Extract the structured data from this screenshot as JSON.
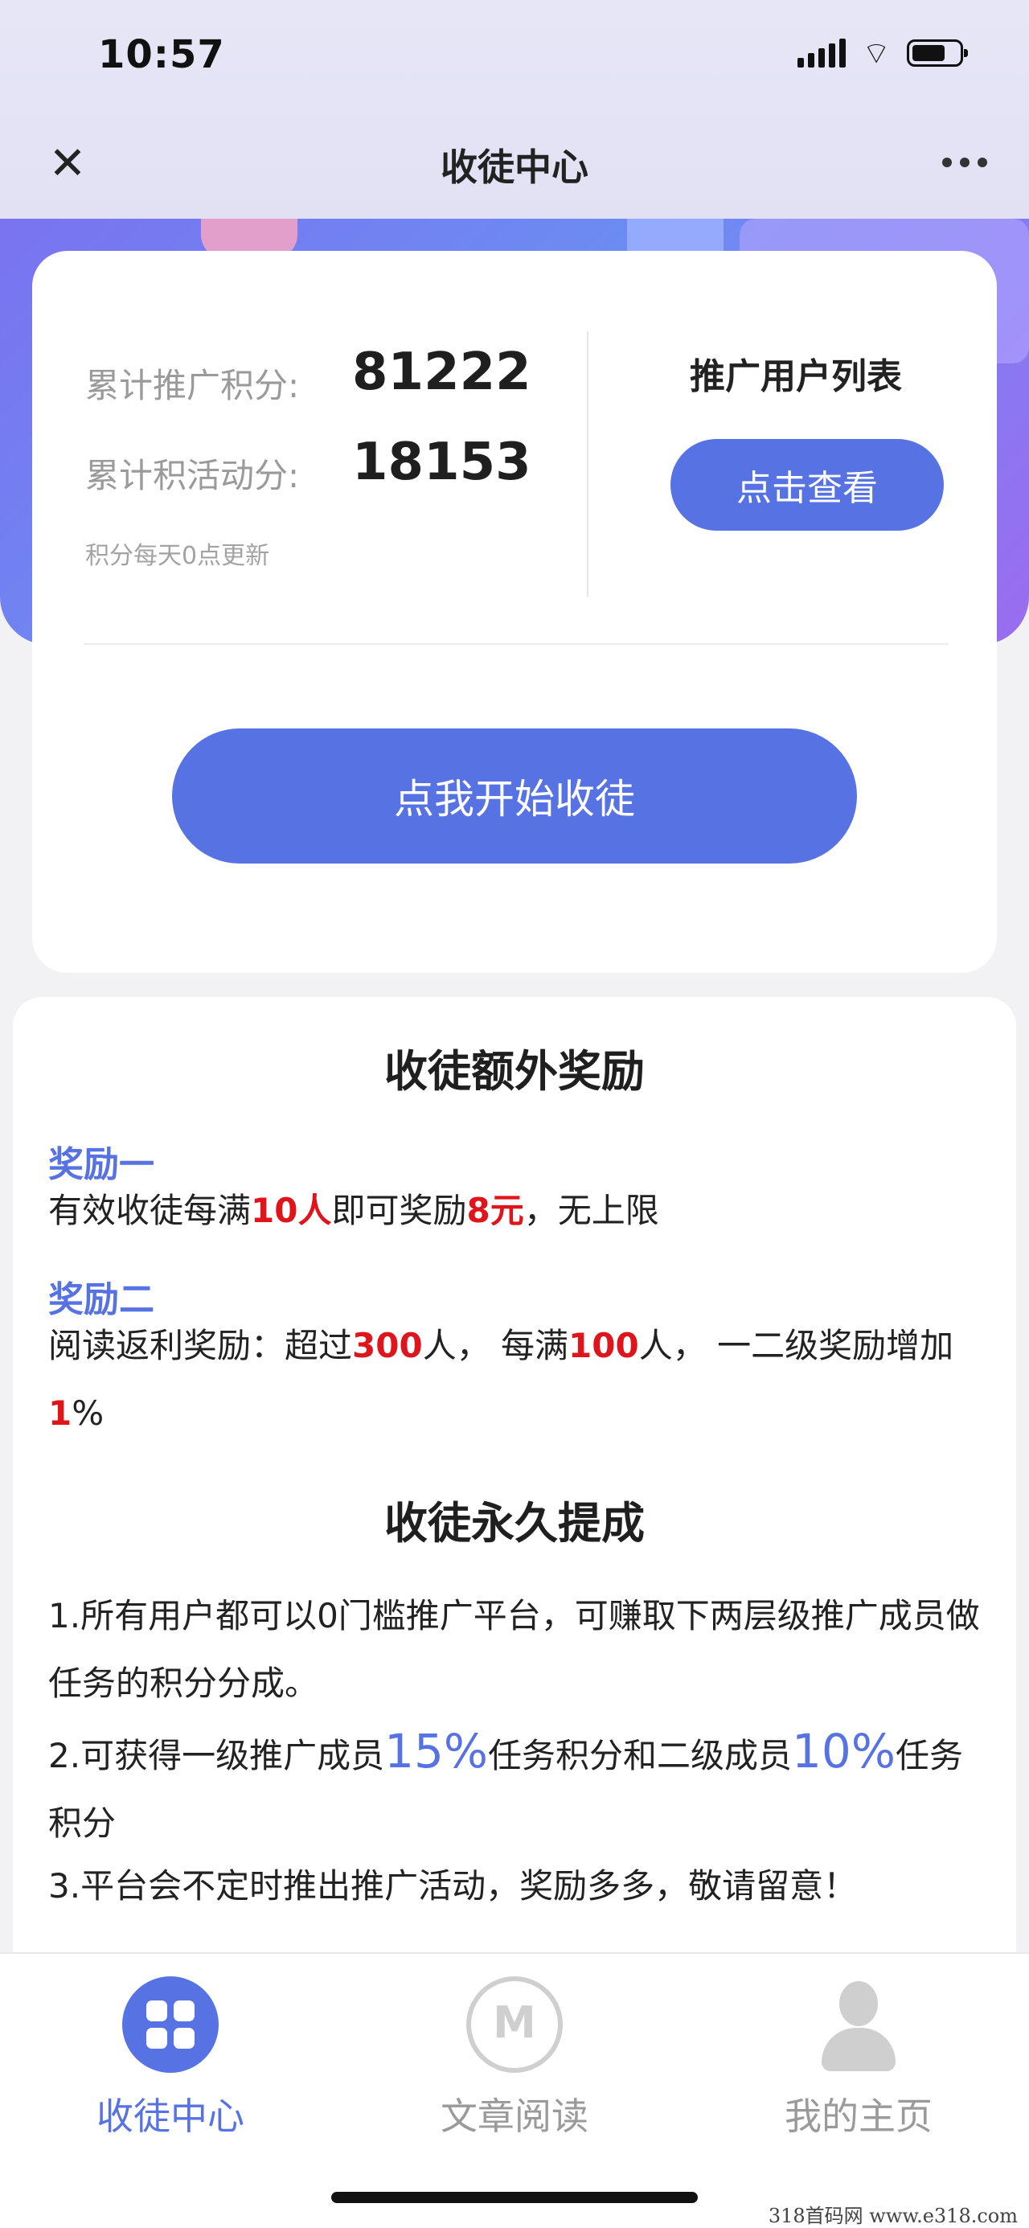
{
  "status_bar": {
    "time": "10:57"
  },
  "nav": {
    "title": "收徒中心"
  },
  "stats": {
    "promo_points_label": "累计推广积分:",
    "promo_points_value": "81222",
    "activity_points_label": "累计积活动分:",
    "activity_points_value": "18153",
    "note": "积分每天0点更新"
  },
  "user_list": {
    "title": "推广用户列表",
    "button_label": "点击查看"
  },
  "start_button": {
    "label": "点我开始收徒"
  },
  "rewards": {
    "title": "收徒额外奖励",
    "reward1": {
      "head": "奖励一",
      "t1": "有效收徒每满",
      "h1": "10人",
      "t2": "即可奖励",
      "h2": "8元",
      "t3": "，无上限"
    },
    "reward2": {
      "head": "奖励二",
      "t1": "阅读返利奖励：超过",
      "h1": "300",
      "t2": "人，  每满",
      "h2": "100",
      "t3": "人，  一二级奖励增加",
      "h3": "1",
      "t4": "%"
    }
  },
  "commission": {
    "title": "收徒永久提成",
    "line1": "1.所有用户都可以0门槛推广平台，可赚取下两层级推广成员做任务的积分分成。",
    "line2": {
      "t1": "2.可获得一级推广成员",
      "p1": "15%",
      "t2": "任务积分和二级成员",
      "p2": "10%",
      "t3": "任务积分"
    },
    "line3": "3.平台会不定时推出推广活动，奖励多多，敬请留意！"
  },
  "tabbar": {
    "tabs": [
      {
        "label": "收徒中心",
        "active": true
      },
      {
        "label": "文章阅读",
        "active": false
      },
      {
        "label": "我的主页",
        "active": false
      }
    ]
  },
  "watermark": "318首码网   www.e318.com",
  "colors": {
    "accent": "#5672e3",
    "highlight": "#e0141b"
  }
}
